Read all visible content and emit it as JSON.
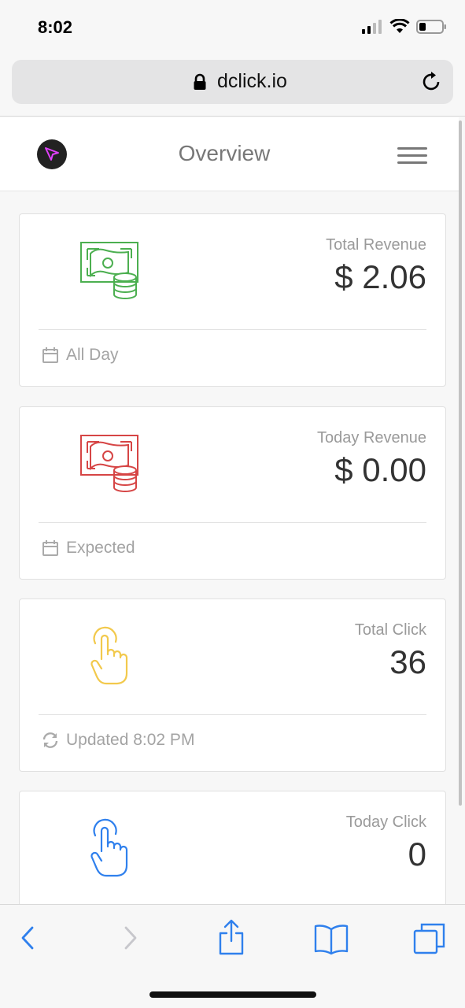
{
  "status_bar": {
    "time": "8:02"
  },
  "browser": {
    "url": "dclick.io"
  },
  "app": {
    "title": "Overview"
  },
  "cards": [
    {
      "label": "Total Revenue",
      "value": "$ 2.06",
      "footer": "All Day",
      "icon": "money-coins-icon",
      "icon_color": "#4caf50",
      "footer_icon": "calendar-icon"
    },
    {
      "label": "Today Revenue",
      "value": "$ 0.00",
      "footer": "Expected",
      "icon": "money-coins-icon",
      "icon_color": "#d64545",
      "footer_icon": "calendar-icon"
    },
    {
      "label": "Total Click",
      "value": "36",
      "footer": "Updated 8:02 PM",
      "icon": "hand-pointer-icon",
      "icon_color": "#f2c94c",
      "footer_icon": "refresh-icon"
    },
    {
      "label": "Today Click",
      "value": "0",
      "footer": "",
      "icon": "hand-pointer-icon",
      "icon_color": "#2f80ed"
    }
  ],
  "colors": {
    "toolbar_accent": "#2f80ed"
  }
}
